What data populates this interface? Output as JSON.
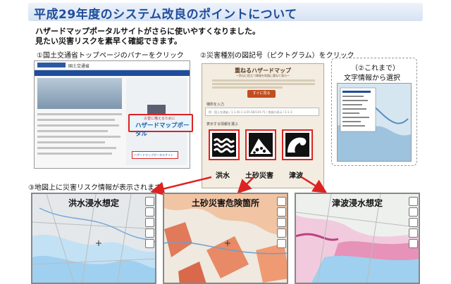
{
  "title": "平成29年度のシステム改良のポイントについて",
  "lead": {
    "line1": "ハザードマップポータルサイトがさらに使いやすくなりました。",
    "line2": "見たい災害リスクを素早く確認できます。"
  },
  "steps": {
    "step1": "①国土交通省トップページのバナーをクリック",
    "step2": "②災害種別の図記号（ピクトグラム）をクリック",
    "step2b_line1": "（②これまで）",
    "step2b_line2": "文字情報から選択",
    "step3": "③地図上に災害リスク情報が表示されます。"
  },
  "mlit_page": {
    "site_name": "国土交通省",
    "banner_small": "災害に備えるために",
    "banner_label": "ハザードマップポータル",
    "lower_label": "ハザードマップポータルサイト"
  },
  "portal": {
    "title": "重ねるハザードマップ",
    "subtitle": "〜防災に役立つ情報を地図に重ねて表示〜",
    "button": "すぐに見る",
    "search_label": "場所を入力",
    "search_placeholder": "例：国土交通省 / 1.1.40.1.1/35.68/139.75 / 地図の表示 / 2-1-3",
    "select_label": "表示する情報を選ぶ"
  },
  "pictograms": [
    {
      "label": "洪水",
      "icon": "flood-icon"
    },
    {
      "label": "土砂災害",
      "icon": "landslide-icon"
    },
    {
      "label": "津波",
      "icon": "tsunami-icon"
    }
  ],
  "maps": [
    {
      "caption": "洪水浸水想定"
    },
    {
      "caption": "土砂災害危険箇所"
    },
    {
      "caption": "津波浸水想定"
    }
  ],
  "colors": {
    "title_blue": "#1f4e9a",
    "highlight_red": "#dd2222",
    "portal_bg": "#f3ece0",
    "portal_button": "#c24d1e"
  }
}
